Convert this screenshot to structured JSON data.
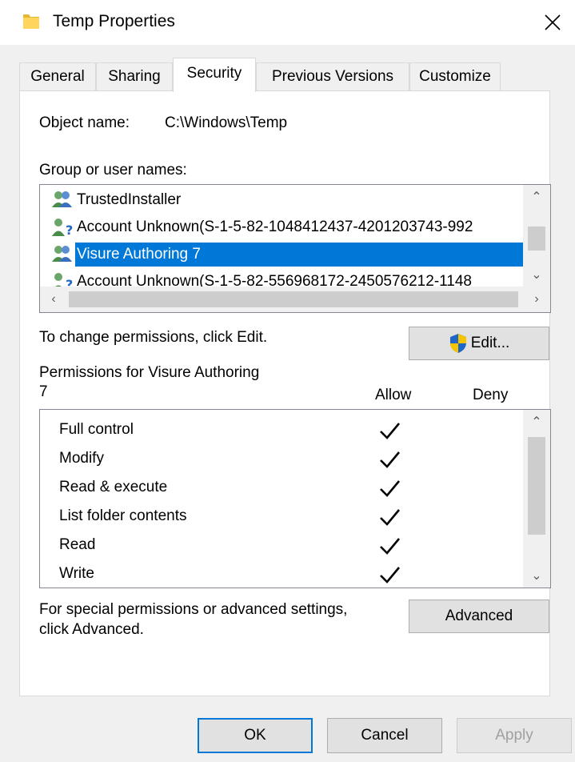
{
  "window": {
    "title": "Temp Properties",
    "close_glyph": "✕",
    "folder_icon": "folder-icon",
    "folder_color": "#ffd55c"
  },
  "tabs": [
    {
      "label": "General",
      "active": false
    },
    {
      "label": "Sharing",
      "active": false
    },
    {
      "label": "Security",
      "active": true
    },
    {
      "label": "Previous Versions",
      "active": false
    },
    {
      "label": "Customize",
      "active": false
    }
  ],
  "security": {
    "object_name_label": "Object name:",
    "object_name_value": "C:\\Windows\\Temp",
    "group_label": "Group or user names:",
    "users": [
      {
        "name": "TrustedInstaller",
        "icon": "user-group-icon",
        "selected": false
      },
      {
        "name": "Account Unknown(S-1-5-82-1048412437-4201203743-992",
        "icon": "unknown-user-icon",
        "selected": false
      },
      {
        "name": "Visure Authoring 7",
        "icon": "user-group-icon",
        "selected": true
      },
      {
        "name": "Account Unknown(S-1-5-82-556968172-2450576212-1148",
        "icon": "unknown-user-icon",
        "selected": false
      }
    ],
    "change_text": "To change permissions, click Edit.",
    "edit_label": "Edit...",
    "permissions_for_line1": "Permissions for Visure Authoring",
    "permissions_for_line2": "7",
    "allow_header": "Allow",
    "deny_header": "Deny",
    "permissions": [
      {
        "name": "Full control",
        "allow": true,
        "deny": false
      },
      {
        "name": "Modify",
        "allow": true,
        "deny": false
      },
      {
        "name": "Read & execute",
        "allow": true,
        "deny": false
      },
      {
        "name": "List folder contents",
        "allow": true,
        "deny": false
      },
      {
        "name": "Read",
        "allow": true,
        "deny": false
      },
      {
        "name": "Write",
        "allow": true,
        "deny": false
      }
    ],
    "special_line1": "For special permissions or advanced settings,",
    "special_line2": "click Advanced.",
    "advanced_label": "Advanced"
  },
  "footer": {
    "ok_label": "OK",
    "cancel_label": "Cancel",
    "apply_label": "Apply"
  },
  "colors": {
    "selection": "#0078d7",
    "shield_blue": "#1f66c7",
    "shield_yellow": "#f4c400"
  }
}
